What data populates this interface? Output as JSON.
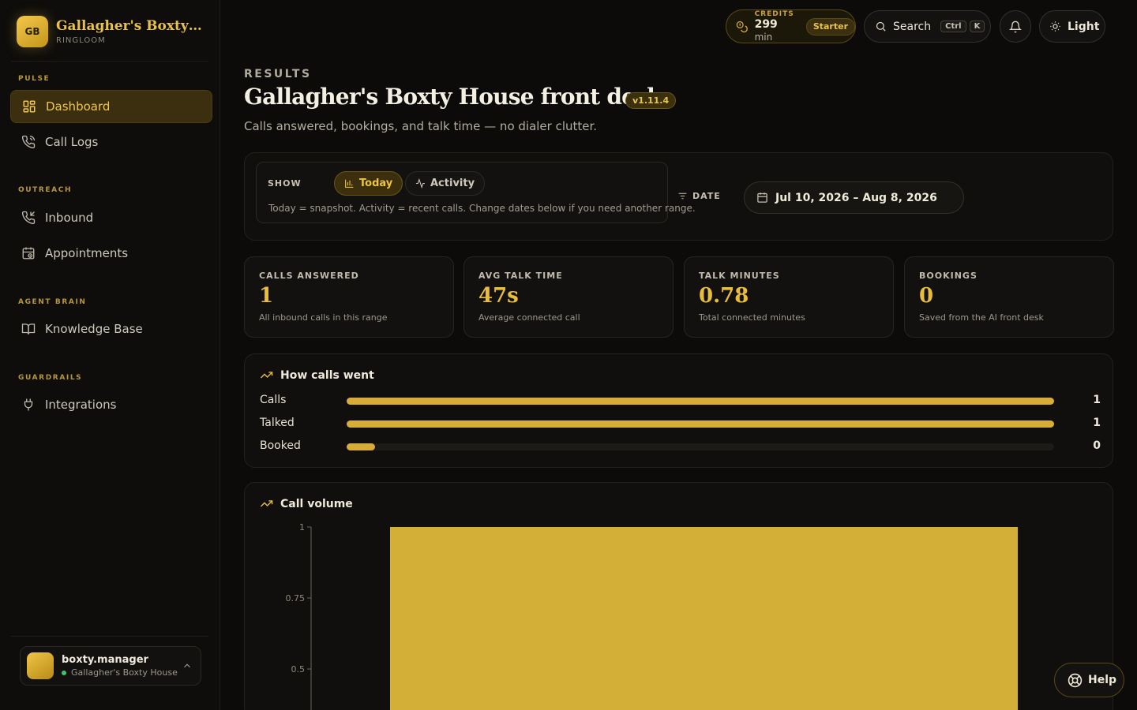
{
  "brand": {
    "logo": "GB",
    "name": "Gallagher's Boxty H...",
    "sub": "RINGLOOM"
  },
  "sidebar": {
    "sections": [
      {
        "label": "PULSE"
      },
      {
        "label": "OUTREACH"
      },
      {
        "label": "AGENT BRAIN"
      },
      {
        "label": "GUARDRAILS"
      }
    ],
    "items": [
      {
        "label": "Dashboard",
        "icon": "dashboard-grid-icon",
        "active": true
      },
      {
        "label": "Call Logs",
        "icon": "phone-icon"
      },
      {
        "label": "Inbound",
        "icon": "phone-incoming-icon"
      },
      {
        "label": "Appointments",
        "icon": "calendar-clock-icon"
      },
      {
        "label": "Knowledge Base",
        "icon": "book-open-icon"
      },
      {
        "label": "Integrations",
        "icon": "plug-icon"
      }
    ],
    "user": {
      "name": "boxty.manager",
      "org": "Gallagher's Boxty House",
      "status_color": "#3ec46d"
    }
  },
  "topbar": {
    "credits_label": "CREDITS",
    "credits_value": "299",
    "credits_unit": "min",
    "plan": "Starter",
    "search_label": "Search",
    "search_keys": [
      "Ctrl",
      "K"
    ],
    "theme_label": "Light"
  },
  "header": {
    "eyebrow": "RESULTS",
    "title": "Gallagher's Boxty House front desk",
    "version": "v1.11.4",
    "subtitle": "Calls answered, bookings, and talk time — no dialer clutter."
  },
  "filters": {
    "show_label": "SHOW",
    "options": [
      "Today",
      "Activity"
    ],
    "selected": "Today",
    "hint": "Today = snapshot. Activity = recent calls. Change dates below if you need another range.",
    "date_label": "DATE",
    "date_range": "Jul 10, 2026 – Aug 8, 2026"
  },
  "kpis": [
    {
      "label": "CALLS ANSWERED",
      "value": "1",
      "desc": "All inbound calls in this range"
    },
    {
      "label": "AVG TALK TIME",
      "value": "47s",
      "desc": "Average connected call"
    },
    {
      "label": "TALK MINUTES",
      "value": "0.78",
      "desc": "Total connected minutes"
    },
    {
      "label": "BOOKINGS",
      "value": "0",
      "desc": "Saved from the AI front desk"
    }
  ],
  "funnel": {
    "title": "How calls went",
    "rows": [
      {
        "label": "Calls",
        "value": "1",
        "fraction": 1
      },
      {
        "label": "Talked",
        "value": "1",
        "fraction": 1
      },
      {
        "label": "Booked",
        "value": "0",
        "fraction": 0.04
      }
    ]
  },
  "volume_title": "Call volume",
  "chart_data": {
    "type": "bar",
    "categories": [
      ""
    ],
    "values": [
      1
    ],
    "ylim": [
      0,
      1
    ],
    "yticks": [
      "1",
      "0.75",
      "0.5"
    ],
    "color": "#d4af37"
  },
  "help_label": "Help",
  "colors": {
    "accent": "#e9bd3c",
    "background": "#0c0b09"
  }
}
